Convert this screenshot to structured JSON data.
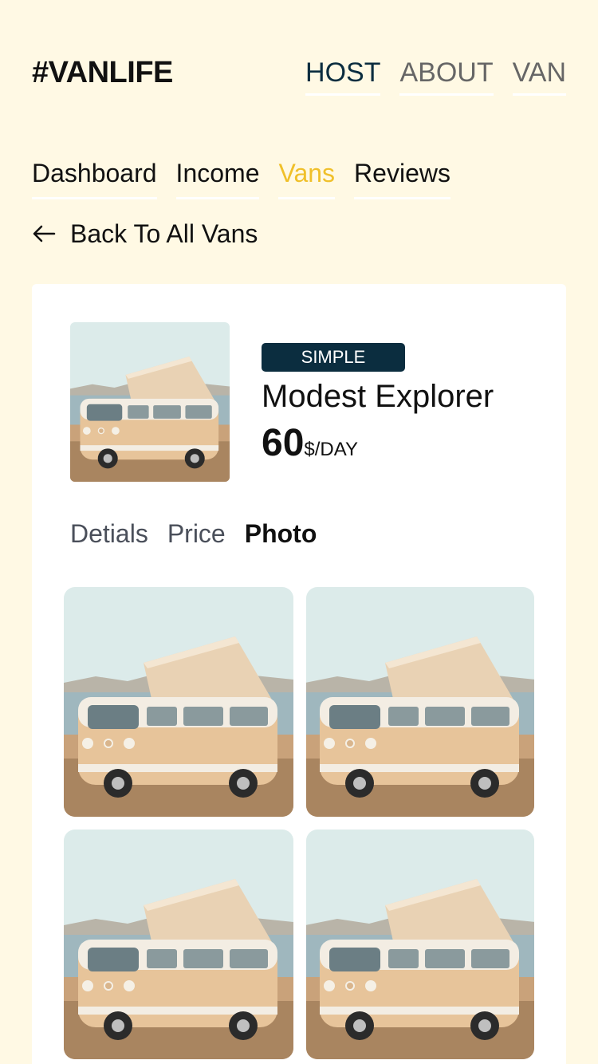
{
  "header": {
    "logo": "#VANLIFE",
    "nav": [
      "HOST",
      "ABOUT",
      "VAN"
    ]
  },
  "subnav": [
    "Dashboard",
    "Income",
    "Vans",
    "Reviews"
  ],
  "back_link": "Back To All Vans",
  "van": {
    "type_badge": "SIMPLE",
    "name": "Modest Explorer",
    "price": "60",
    "price_unit": "$/DAY"
  },
  "detail_tabs": [
    "Detials",
    "Price",
    "Photo"
  ],
  "colors": {
    "background": "#FFF9E4",
    "accent": "#F0C02A",
    "badge": "#0B2D3F"
  },
  "icons": [
    "arrow-left-icon"
  ]
}
